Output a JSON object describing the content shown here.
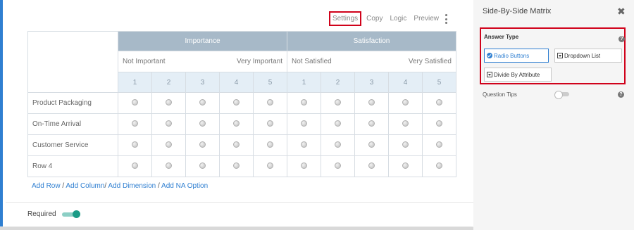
{
  "toolbar": {
    "settings": "Settings",
    "copy": "Copy",
    "logic": "Logic",
    "preview": "Preview",
    "more_icon": "kebab-icon"
  },
  "matrix": {
    "dimensions": [
      {
        "name": "Importance",
        "low_label": "Not Important",
        "high_label": "Very Important",
        "scale": [
          "1",
          "2",
          "3",
          "4",
          "5"
        ]
      },
      {
        "name": "Satisfaction",
        "low_label": "Not Satisfied",
        "high_label": "Very Satisfied",
        "scale": [
          "1",
          "2",
          "3",
          "4",
          "5"
        ]
      }
    ],
    "rows": [
      "Product Packaging",
      "On-Time Arrival",
      "Customer Service",
      "Row 4"
    ]
  },
  "links": {
    "add_row": "Add Row",
    "add_column": "Add Column",
    "add_dimension": "Add Dimension",
    "add_na": "Add NA Option",
    "sep": "/"
  },
  "required": {
    "label": "Required",
    "on": true
  },
  "panel": {
    "title": "Side-By-Side Matrix",
    "close_icon": "close-icon",
    "answer_type": {
      "label": "Answer Type",
      "options": [
        {
          "label": "Radio Buttons",
          "selected": true
        },
        {
          "label": "Dropdown List",
          "selected": false
        },
        {
          "label": "Divide By Attribute",
          "selected": false
        }
      ]
    },
    "question_tips": {
      "label": "Question Tips",
      "on": false
    }
  },
  "colors": {
    "accent": "#2f7fd1",
    "highlight": "#d0021b",
    "toggle_on": "#1a9b86",
    "dimension_header": "#a7b9c8",
    "scale_row": "#e4eef6"
  }
}
